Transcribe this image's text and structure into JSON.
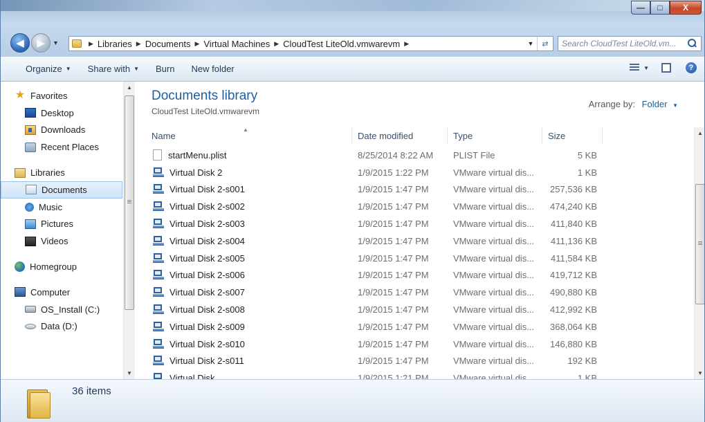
{
  "window": {
    "minimize_glyph": "—",
    "maximize_glyph": "□",
    "close_glyph": "X"
  },
  "navigation": {
    "back_icon": "back-arrow-icon",
    "forward_icon": "forward-arrow-icon"
  },
  "address_bar": {
    "crumbs": [
      "Libraries",
      "Documents",
      "Virtual Machines",
      "CloudTest LiteOld.vmwarevm"
    ]
  },
  "search": {
    "placeholder": "Search CloudTest LiteOld.vm..."
  },
  "toolbar": {
    "organize": "Organize",
    "share_with": "Share with",
    "burn": "Burn",
    "new_folder": "New folder"
  },
  "nav_pane": {
    "favorites": {
      "label": "Favorites",
      "items": [
        "Desktop",
        "Downloads",
        "Recent Places"
      ]
    },
    "libraries": {
      "label": "Libraries",
      "items": [
        "Documents",
        "Music",
        "Pictures",
        "Videos"
      ],
      "selected": "Documents"
    },
    "homegroup": {
      "label": "Homegroup"
    },
    "computer": {
      "label": "Computer",
      "items": [
        "OS_Install (C:)",
        "Data (D:)"
      ]
    }
  },
  "content": {
    "library_title": "Documents library",
    "library_subtitle": "CloudTest LiteOld.vmwarevm",
    "arrange_label": "Arrange by:",
    "arrange_value": "Folder",
    "columns": [
      "Name",
      "Date modified",
      "Type",
      "Size"
    ],
    "files": [
      {
        "name": "startMenu.plist",
        "date": "8/25/2014 8:22 AM",
        "type": "PLIST File",
        "size": "5 KB",
        "icon": "plist-file-icon"
      },
      {
        "name": "Virtual Disk 2",
        "date": "1/9/2015 1:22 PM",
        "type": "VMware virtual dis...",
        "size": "1 KB",
        "icon": "vmdk-file-icon"
      },
      {
        "name": "Virtual Disk 2-s001",
        "date": "1/9/2015 1:47 PM",
        "type": "VMware virtual dis...",
        "size": "257,536 KB",
        "icon": "vmdk-file-icon"
      },
      {
        "name": "Virtual Disk 2-s002",
        "date": "1/9/2015 1:47 PM",
        "type": "VMware virtual dis...",
        "size": "474,240 KB",
        "icon": "vmdk-file-icon"
      },
      {
        "name": "Virtual Disk 2-s003",
        "date": "1/9/2015 1:47 PM",
        "type": "VMware virtual dis...",
        "size": "411,840 KB",
        "icon": "vmdk-file-icon"
      },
      {
        "name": "Virtual Disk 2-s004",
        "date": "1/9/2015 1:47 PM",
        "type": "VMware virtual dis...",
        "size": "411,136 KB",
        "icon": "vmdk-file-icon"
      },
      {
        "name": "Virtual Disk 2-s005",
        "date": "1/9/2015 1:47 PM",
        "type": "VMware virtual dis...",
        "size": "411,584 KB",
        "icon": "vmdk-file-icon"
      },
      {
        "name": "Virtual Disk 2-s006",
        "date": "1/9/2015 1:47 PM",
        "type": "VMware virtual dis...",
        "size": "419,712 KB",
        "icon": "vmdk-file-icon"
      },
      {
        "name": "Virtual Disk 2-s007",
        "date": "1/9/2015 1:47 PM",
        "type": "VMware virtual dis...",
        "size": "490,880 KB",
        "icon": "vmdk-file-icon"
      },
      {
        "name": "Virtual Disk 2-s008",
        "date": "1/9/2015 1:47 PM",
        "type": "VMware virtual dis...",
        "size": "412,992 KB",
        "icon": "vmdk-file-icon"
      },
      {
        "name": "Virtual Disk 2-s009",
        "date": "1/9/2015 1:47 PM",
        "type": "VMware virtual dis...",
        "size": "368,064 KB",
        "icon": "vmdk-file-icon"
      },
      {
        "name": "Virtual Disk 2-s010",
        "date": "1/9/2015 1:47 PM",
        "type": "VMware virtual dis...",
        "size": "146,880 KB",
        "icon": "vmdk-file-icon"
      },
      {
        "name": "Virtual Disk 2-s011",
        "date": "1/9/2015 1:47 PM",
        "type": "VMware virtual dis...",
        "size": "192 KB",
        "icon": "vmdk-file-icon"
      },
      {
        "name": "Virtual Disk",
        "date": "1/9/2015 1:21 PM",
        "type": "VMware virtual dis...",
        "size": "1 KB",
        "icon": "vmdk-file-icon"
      }
    ]
  },
  "details_pane": {
    "item_count": "36 items"
  },
  "colors": {
    "accent_blue": "#1e5e9c",
    "selection_bg": "#cfe4f8",
    "chrome_blue": "#b7cde6"
  }
}
